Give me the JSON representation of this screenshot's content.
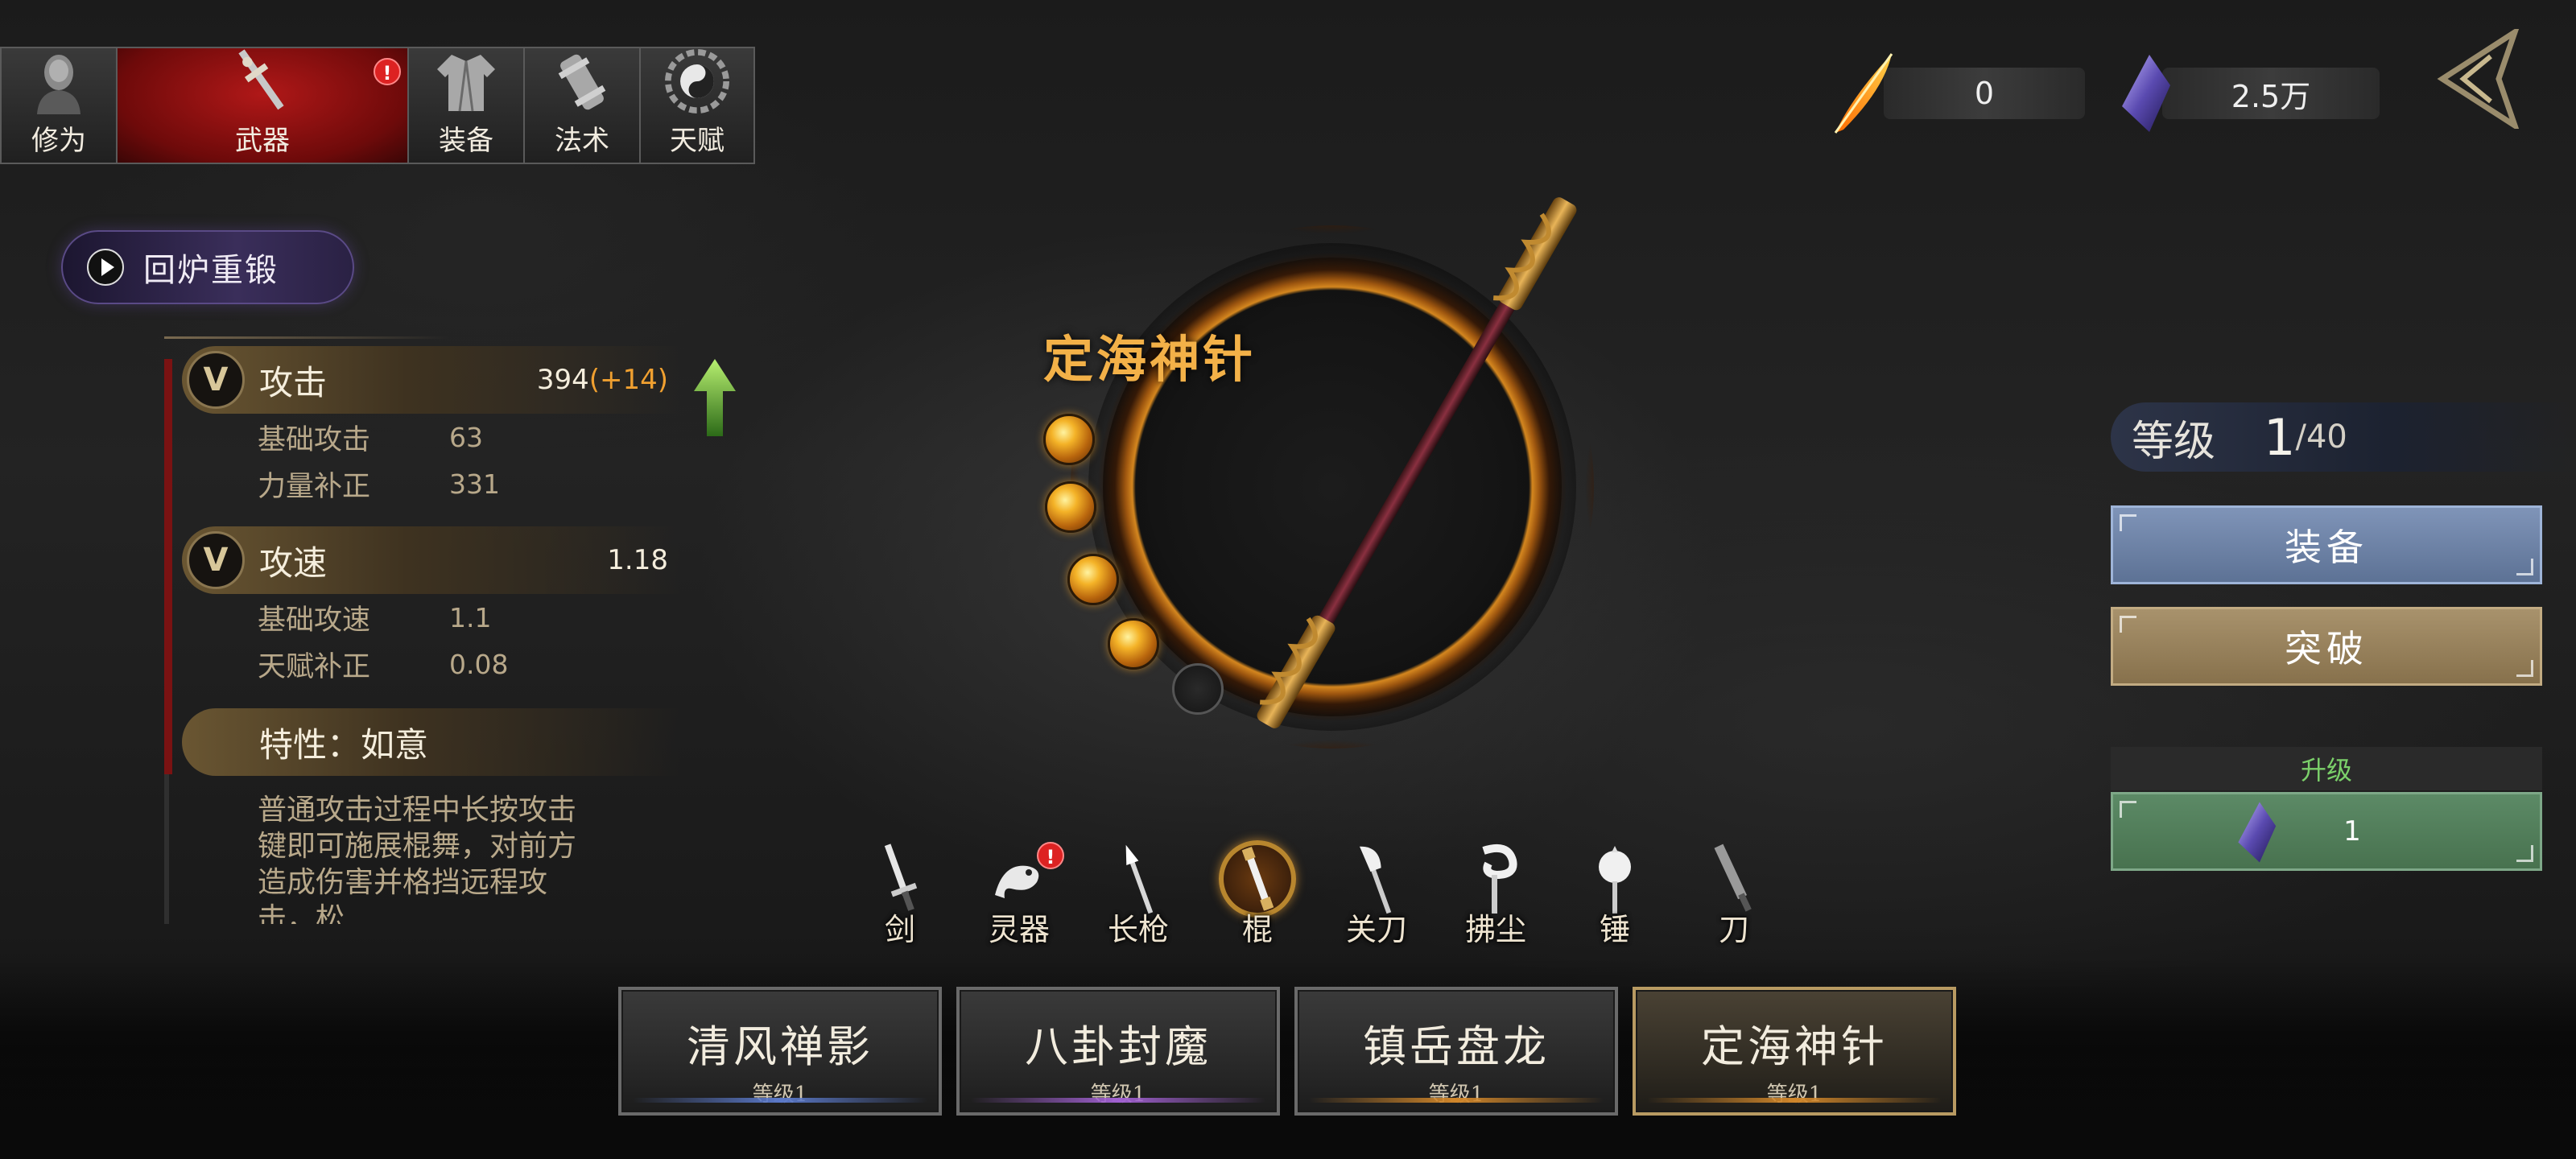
{
  "categories": [
    {
      "label": "修为",
      "icon": "monk-head-icon"
    },
    {
      "label": "武器",
      "icon": "sword-icon",
      "active": true,
      "alert": "!"
    },
    {
      "label": "装备",
      "icon": "robe-icon"
    },
    {
      "label": "法术",
      "icon": "scroll-icon"
    },
    {
      "label": "天赋",
      "icon": "bagua-icon"
    }
  ],
  "reforge_label": "回炉重锻",
  "stats": {
    "attack": {
      "title": "攻击",
      "value": "394",
      "bonus": "(+14)",
      "rows": [
        {
          "label": "基础攻击",
          "value": "63"
        },
        {
          "label": "力量补正",
          "value": "331"
        }
      ]
    },
    "speed": {
      "title": "攻速",
      "value": "1.18",
      "rows": [
        {
          "label": "基础攻速",
          "value": "1.1"
        },
        {
          "label": "天赋补正",
          "value": "0.08"
        }
      ]
    },
    "trait": {
      "title": "特性：如意",
      "description": "普通攻击过程中长按攻击键即可施展棍舞，对前方造成伤害并格挡远程攻击，松"
    }
  },
  "weapon": {
    "name": "定海神针",
    "orbs_filled": 4,
    "orbs_total": 5
  },
  "weapon_types": [
    {
      "label": "剑",
      "icon": "sword-icon"
    },
    {
      "label": "灵器",
      "icon": "dragon-icon",
      "alert": "!"
    },
    {
      "label": "长枪",
      "icon": "spear-icon"
    },
    {
      "label": "棍",
      "icon": "staff-icon",
      "active": true
    },
    {
      "label": "关刀",
      "icon": "guandao-icon"
    },
    {
      "label": "拂尘",
      "icon": "whisk-icon"
    },
    {
      "label": "锤",
      "icon": "hammer-icon"
    },
    {
      "label": "刀",
      "icon": "saber-icon"
    }
  ],
  "weapon_cards": [
    {
      "name": "清风禅影",
      "level": "等级1",
      "bar_color": "#5a78c8"
    },
    {
      "name": "八卦封魔",
      "level": "等级1",
      "bar_color": "#a060d0"
    },
    {
      "name": "镇岳盘龙",
      "level": "等级1",
      "bar_color": "#d0862a"
    },
    {
      "name": "定海神针",
      "level": "等级1",
      "bar_color": "#d0862a",
      "active": true
    }
  ],
  "resources": {
    "fire_feather": {
      "value": "0",
      "icon": "flame-feather-icon"
    },
    "crystal": {
      "value": "2.5万",
      "icon": "purple-crystal-icon"
    }
  },
  "right_panel": {
    "level_label": "等级",
    "level_current": "1",
    "level_max": "/40",
    "equip_label": "装备",
    "breakthrough_label": "突破",
    "upgrade_header": "升级",
    "upgrade_cost": "1",
    "upgrade_cost_icon": "purple-crystal-icon"
  },
  "colors": {
    "accent_gold": "#f3b148",
    "active_tab_red": "#b01818",
    "equip_blue": "#6d82a6",
    "breakthrough_tan": "#97815c",
    "upgrade_green": "#527c5a"
  }
}
